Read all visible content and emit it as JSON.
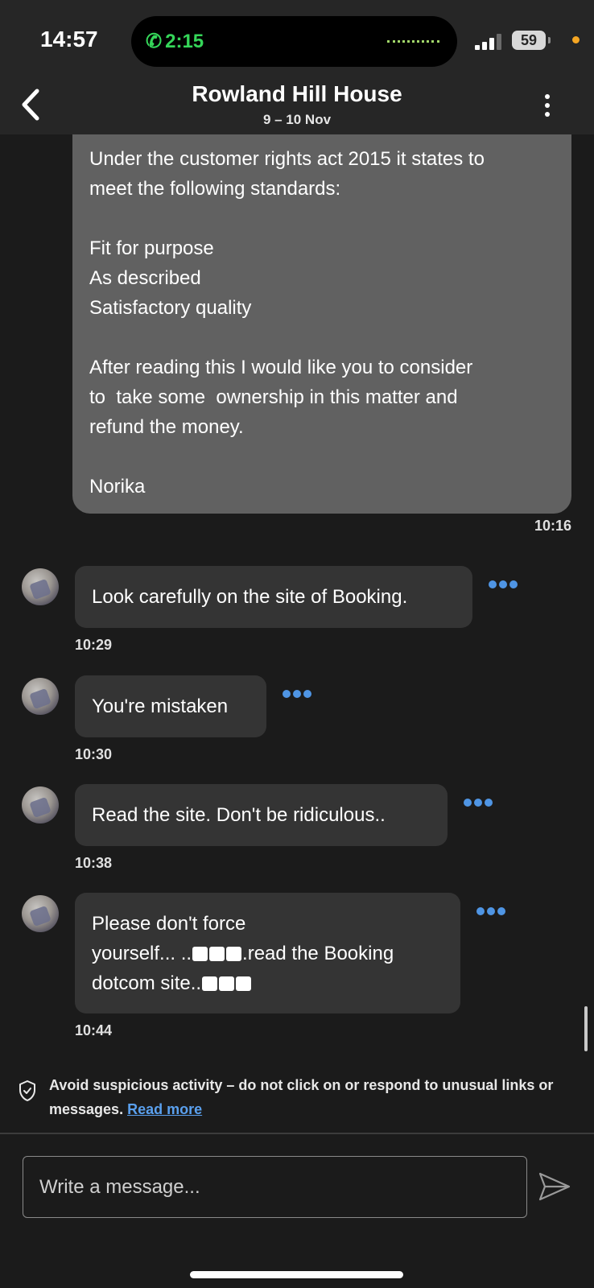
{
  "status_bar": {
    "time": "14:57",
    "call_icon": "phone-icon",
    "call_duration": "2:15",
    "battery": "59",
    "colors": {
      "call": "#35d659",
      "privacy_dot": "#f5a623"
    }
  },
  "header": {
    "back_icon": "chevron-left-icon",
    "title": "Rowland Hill House",
    "subtitle": "9 – 10 Nov",
    "menu_icon": "more-vertical-icon"
  },
  "messages": {
    "outgoing": {
      "lines": [
        "Under the customer rights act 2015 it states to",
        "meet the following standards:",
        "",
        "Fit for purpose",
        "As described",
        "Satisfactory quality",
        "",
        "After reading this I would like you to consider",
        "to  take some  ownership in this matter and",
        "refund the money.",
        "",
        "Norika"
      ],
      "time": "10:16"
    },
    "incoming": [
      {
        "text": "Look carefully on the site of Booking.",
        "time": "10:29"
      },
      {
        "text": "You're mistaken",
        "time": "10:30"
      },
      {
        "text": "Read the site. Don't be ridiculous..",
        "time": "10:38"
      },
      {
        "line1": "Please don't force",
        "line2_a": "yourself... ..",
        "line2_b": ".read the Booking",
        "line3": "dotcom site..",
        "time": "10:44"
      }
    ]
  },
  "warning": {
    "icon": "shield-check-icon",
    "text": "Avoid suspicious activity – do not click on or respond to unusual links or messages. ",
    "link": "Read more"
  },
  "composer": {
    "placeholder": "Write a message...",
    "send_icon": "send-icon"
  },
  "colors": {
    "background": "#1b1b1b",
    "header": "#262626",
    "outgoing_bubble": "#616161",
    "incoming_bubble": "#343434",
    "accent": "#4f95e4"
  }
}
